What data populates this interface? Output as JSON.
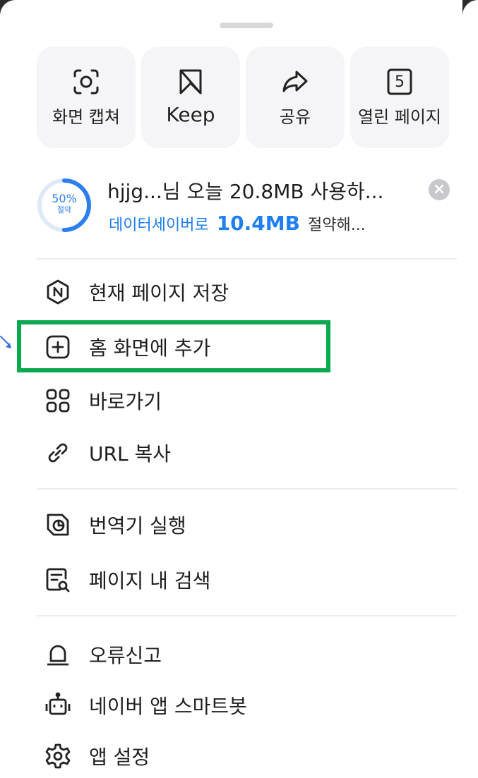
{
  "quick_actions": [
    {
      "icon": "capture-icon",
      "label": "화면 캡쳐"
    },
    {
      "icon": "bookmark-icon",
      "label": "Keep"
    },
    {
      "icon": "share-icon",
      "label": "공유"
    },
    {
      "icon": "tabs-count-icon",
      "label": "열린 페이지",
      "count": "5"
    }
  ],
  "data_saver": {
    "ring_percent": "50%",
    "ring_sub": "절약",
    "progress": 0.5,
    "line1": "hjjg...님 오늘 20.8MB 사용하...",
    "line2_prefix": "데이터세이버로",
    "line2_amount": "10.4MB",
    "line2_suffix": "절약해..."
  },
  "menu": {
    "save_page": "현재 페이지 저장",
    "add_home": "홈 화면에 추가",
    "shortcuts": "바로가기",
    "copy_url": "URL 복사",
    "translator": "번역기 실행",
    "find_in_page": "페이지 내 검색",
    "report_error": "오류신고",
    "smartbot": "네이버 앱 스마트봇",
    "app_settings": "앱 설정"
  },
  "colors": {
    "accent": "#1e7ef2",
    "highlight": "#0aa84f",
    "chip_bg": "#f5f5f7"
  }
}
